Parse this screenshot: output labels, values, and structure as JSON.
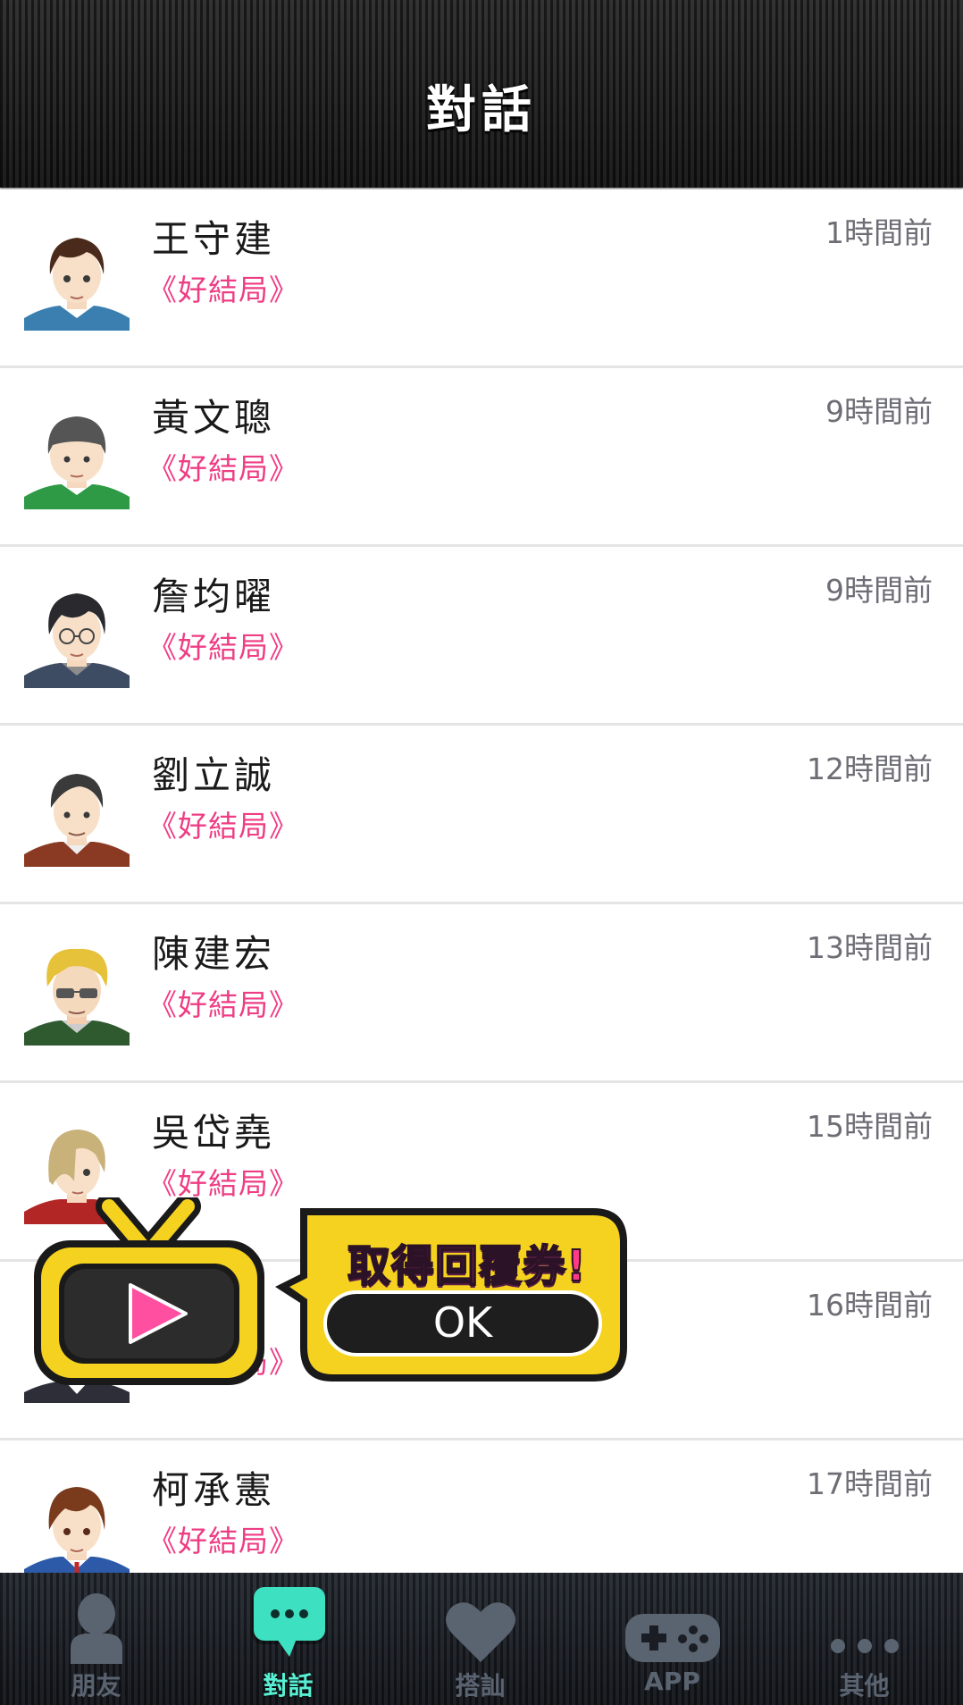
{
  "header": {
    "title": "對話"
  },
  "conversations": [
    {
      "name": "王守建",
      "chapter": "《好結局》",
      "time": "1時間前"
    },
    {
      "name": "黃文聰",
      "chapter": "《好結局》",
      "time": "9時間前"
    },
    {
      "name": "詹均曜",
      "chapter": "《好結局》",
      "time": "9時間前"
    },
    {
      "name": "劉立誠",
      "chapter": "《好結局》",
      "time": "12時間前"
    },
    {
      "name": "陳建宏",
      "chapter": "《好結局》",
      "time": "13時間前"
    },
    {
      "name": "吳岱堯",
      "chapter": "《好結局》",
      "time": "15時間前"
    },
    {
      "name": "",
      "chapter": "《好結局》",
      "time": "16時間前"
    },
    {
      "name": "柯承憲",
      "chapter": "《好結局》",
      "time": "17時間前"
    }
  ],
  "reward_popup": {
    "title": "取得回覆券!",
    "ok_label": "OK"
  },
  "tabbar": {
    "tabs": [
      {
        "label": "朋友",
        "icon": "person-icon",
        "active": false
      },
      {
        "label": "對話",
        "icon": "chat-bubble-icon",
        "active": true
      },
      {
        "label": "搭訕",
        "icon": "heart-icon",
        "active": false
      },
      {
        "label": "APP",
        "icon": "gamepad-icon",
        "active": false
      },
      {
        "label": "其他",
        "icon": "more-dots-icon",
        "active": false
      }
    ]
  },
  "colors": {
    "chapter_pink": "#ee3d84",
    "active_tab": "#58f0d4",
    "inactive_tab": "#5a6370",
    "popup_yellow": "#f5d21f"
  }
}
